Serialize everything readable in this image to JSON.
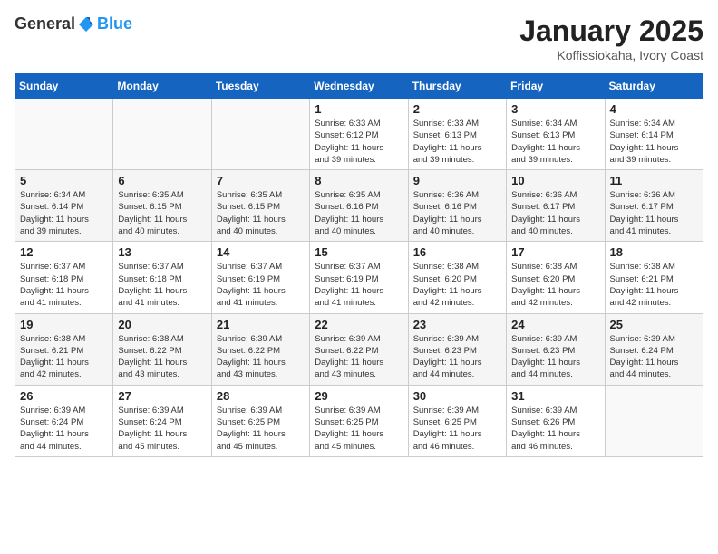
{
  "header": {
    "logo_general": "General",
    "logo_blue": "Blue",
    "month": "January 2025",
    "location": "Koffissiokaha, Ivory Coast"
  },
  "weekdays": [
    "Sunday",
    "Monday",
    "Tuesday",
    "Wednesday",
    "Thursday",
    "Friday",
    "Saturday"
  ],
  "weeks": [
    [
      {
        "day": "",
        "info": ""
      },
      {
        "day": "",
        "info": ""
      },
      {
        "day": "",
        "info": ""
      },
      {
        "day": "1",
        "info": "Sunrise: 6:33 AM\nSunset: 6:12 PM\nDaylight: 11 hours\nand 39 minutes."
      },
      {
        "day": "2",
        "info": "Sunrise: 6:33 AM\nSunset: 6:13 PM\nDaylight: 11 hours\nand 39 minutes."
      },
      {
        "day": "3",
        "info": "Sunrise: 6:34 AM\nSunset: 6:13 PM\nDaylight: 11 hours\nand 39 minutes."
      },
      {
        "day": "4",
        "info": "Sunrise: 6:34 AM\nSunset: 6:14 PM\nDaylight: 11 hours\nand 39 minutes."
      }
    ],
    [
      {
        "day": "5",
        "info": "Sunrise: 6:34 AM\nSunset: 6:14 PM\nDaylight: 11 hours\nand 39 minutes."
      },
      {
        "day": "6",
        "info": "Sunrise: 6:35 AM\nSunset: 6:15 PM\nDaylight: 11 hours\nand 40 minutes."
      },
      {
        "day": "7",
        "info": "Sunrise: 6:35 AM\nSunset: 6:15 PM\nDaylight: 11 hours\nand 40 minutes."
      },
      {
        "day": "8",
        "info": "Sunrise: 6:35 AM\nSunset: 6:16 PM\nDaylight: 11 hours\nand 40 minutes."
      },
      {
        "day": "9",
        "info": "Sunrise: 6:36 AM\nSunset: 6:16 PM\nDaylight: 11 hours\nand 40 minutes."
      },
      {
        "day": "10",
        "info": "Sunrise: 6:36 AM\nSunset: 6:17 PM\nDaylight: 11 hours\nand 40 minutes."
      },
      {
        "day": "11",
        "info": "Sunrise: 6:36 AM\nSunset: 6:17 PM\nDaylight: 11 hours\nand 41 minutes."
      }
    ],
    [
      {
        "day": "12",
        "info": "Sunrise: 6:37 AM\nSunset: 6:18 PM\nDaylight: 11 hours\nand 41 minutes."
      },
      {
        "day": "13",
        "info": "Sunrise: 6:37 AM\nSunset: 6:18 PM\nDaylight: 11 hours\nand 41 minutes."
      },
      {
        "day": "14",
        "info": "Sunrise: 6:37 AM\nSunset: 6:19 PM\nDaylight: 11 hours\nand 41 minutes."
      },
      {
        "day": "15",
        "info": "Sunrise: 6:37 AM\nSunset: 6:19 PM\nDaylight: 11 hours\nand 41 minutes."
      },
      {
        "day": "16",
        "info": "Sunrise: 6:38 AM\nSunset: 6:20 PM\nDaylight: 11 hours\nand 42 minutes."
      },
      {
        "day": "17",
        "info": "Sunrise: 6:38 AM\nSunset: 6:20 PM\nDaylight: 11 hours\nand 42 minutes."
      },
      {
        "day": "18",
        "info": "Sunrise: 6:38 AM\nSunset: 6:21 PM\nDaylight: 11 hours\nand 42 minutes."
      }
    ],
    [
      {
        "day": "19",
        "info": "Sunrise: 6:38 AM\nSunset: 6:21 PM\nDaylight: 11 hours\nand 42 minutes."
      },
      {
        "day": "20",
        "info": "Sunrise: 6:38 AM\nSunset: 6:22 PM\nDaylight: 11 hours\nand 43 minutes."
      },
      {
        "day": "21",
        "info": "Sunrise: 6:39 AM\nSunset: 6:22 PM\nDaylight: 11 hours\nand 43 minutes."
      },
      {
        "day": "22",
        "info": "Sunrise: 6:39 AM\nSunset: 6:22 PM\nDaylight: 11 hours\nand 43 minutes."
      },
      {
        "day": "23",
        "info": "Sunrise: 6:39 AM\nSunset: 6:23 PM\nDaylight: 11 hours\nand 44 minutes."
      },
      {
        "day": "24",
        "info": "Sunrise: 6:39 AM\nSunset: 6:23 PM\nDaylight: 11 hours\nand 44 minutes."
      },
      {
        "day": "25",
        "info": "Sunrise: 6:39 AM\nSunset: 6:24 PM\nDaylight: 11 hours\nand 44 minutes."
      }
    ],
    [
      {
        "day": "26",
        "info": "Sunrise: 6:39 AM\nSunset: 6:24 PM\nDaylight: 11 hours\nand 44 minutes."
      },
      {
        "day": "27",
        "info": "Sunrise: 6:39 AM\nSunset: 6:24 PM\nDaylight: 11 hours\nand 45 minutes."
      },
      {
        "day": "28",
        "info": "Sunrise: 6:39 AM\nSunset: 6:25 PM\nDaylight: 11 hours\nand 45 minutes."
      },
      {
        "day": "29",
        "info": "Sunrise: 6:39 AM\nSunset: 6:25 PM\nDaylight: 11 hours\nand 45 minutes."
      },
      {
        "day": "30",
        "info": "Sunrise: 6:39 AM\nSunset: 6:25 PM\nDaylight: 11 hours\nand 46 minutes."
      },
      {
        "day": "31",
        "info": "Sunrise: 6:39 AM\nSunset: 6:26 PM\nDaylight: 11 hours\nand 46 minutes."
      },
      {
        "day": "",
        "info": ""
      }
    ]
  ]
}
